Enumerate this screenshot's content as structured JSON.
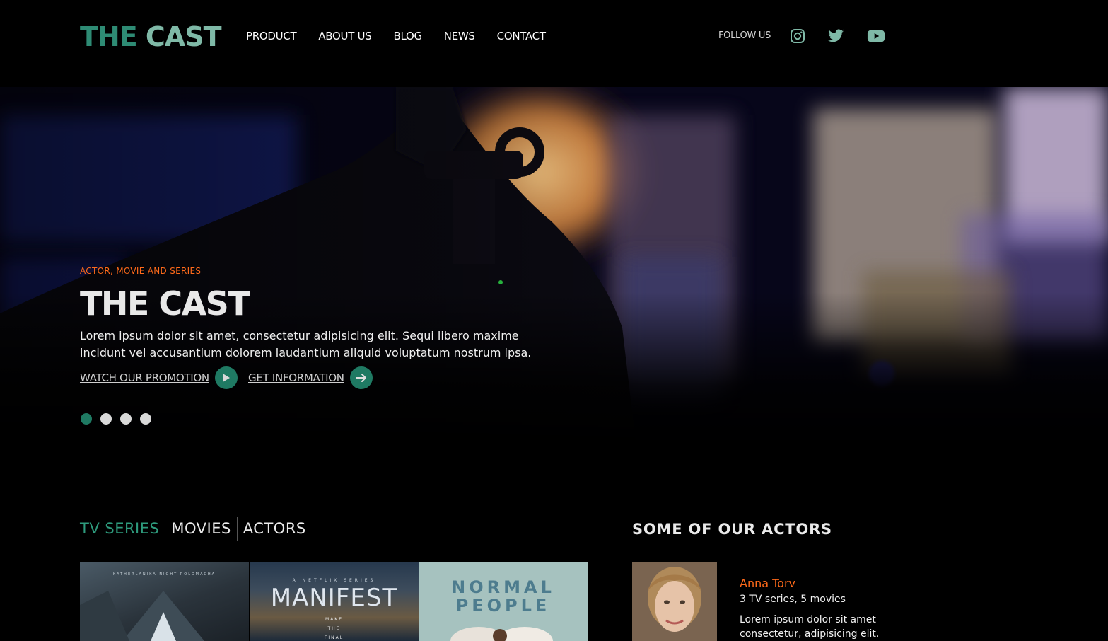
{
  "header": {
    "logo_part1": "THE ",
    "logo_part2": "CAST",
    "nav": [
      "PRODUCT",
      "ABOUT US",
      "BLOG",
      "NEWS",
      "CONTACT"
    ],
    "follow_label": "FOLLOW US",
    "social": [
      "instagram-icon",
      "twitter-icon",
      "youtube-icon"
    ],
    "accent_color": "#2e8b74"
  },
  "hero": {
    "eyebrow": "ACTOR, MOVIE AND SERIES",
    "title": "THE CAST",
    "text": "Lorem ipsum dolor sit amet, consectetur adipisicing elit. Sequi libero maxime incidunt vel accusantium dolorem laudantium aliquid voluptatum nostrum ipsa.",
    "cta_primary": "WATCH OUR PROMOTION",
    "cta_secondary": "GET INFORMATION",
    "slides_count": 4,
    "active_slide": 1,
    "eyebrow_color": "#ff6a1a"
  },
  "tabs": {
    "items": [
      "TV SERIES",
      "MOVIES",
      "ACTORS"
    ],
    "active": "TV SERIES"
  },
  "posters": [
    {
      "top_text": "KATHERLANIKA NIGHT ROLOMACHA"
    },
    {
      "small": "A NETFLIX SERIES",
      "title": "MANIFEST",
      "tagline_1": "MAKE",
      "tagline_2": "THE",
      "tagline_3": "FINAL"
    },
    {
      "title_line1": "NORMAL",
      "title_line2": "PEOPLE"
    }
  ],
  "actors_section": {
    "title": "SOME OF OUR ACTORS",
    "actor": {
      "name": "Anna Torv",
      "meta": "3 TV series, 5 movies",
      "desc": "Lorem ipsum dolor sit amet consectetur, adipisicing elit."
    }
  }
}
